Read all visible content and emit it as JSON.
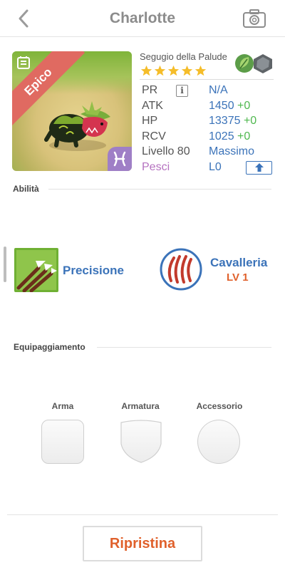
{
  "header": {
    "title": "Charlotte"
  },
  "card": {
    "rarity_label": "Epico"
  },
  "monster": {
    "name": "Segugio della Palude",
    "stars": 5,
    "types": [
      "leaf-type-icon",
      "rock-type-icon"
    ]
  },
  "stats": {
    "pr": {
      "label": "PR",
      "value": "N/A"
    },
    "atk": {
      "label": "ATK",
      "value": "1450",
      "bonus": "+0"
    },
    "hp": {
      "label": "HP",
      "value": "13375",
      "bonus": "+0"
    },
    "rcv": {
      "label": "RCV",
      "value": "1025",
      "bonus": "+0"
    },
    "level": {
      "label": "Livello 80",
      "value": "Massimo"
    },
    "pesci": {
      "label": "Pesci",
      "value": "L0"
    }
  },
  "abilities": {
    "section_label": "Abilità",
    "skill1": {
      "name": "Precisione"
    },
    "skill2": {
      "name": "Cavalleria",
      "level": "LV 1"
    }
  },
  "equipment": {
    "section_label": "Equipaggiamento",
    "slots": [
      {
        "label": "Arma"
      },
      {
        "label": "Armatura"
      },
      {
        "label": "Accessorio"
      }
    ]
  },
  "footer": {
    "reset_label": "Ripristina"
  },
  "colors": {
    "accent_blue": "#3b73b9",
    "accent_orange": "#e0612c",
    "bonus_green": "#4fb84f",
    "pesci_purple": "#b572c0",
    "epic_ribbon": "#e06a61"
  }
}
